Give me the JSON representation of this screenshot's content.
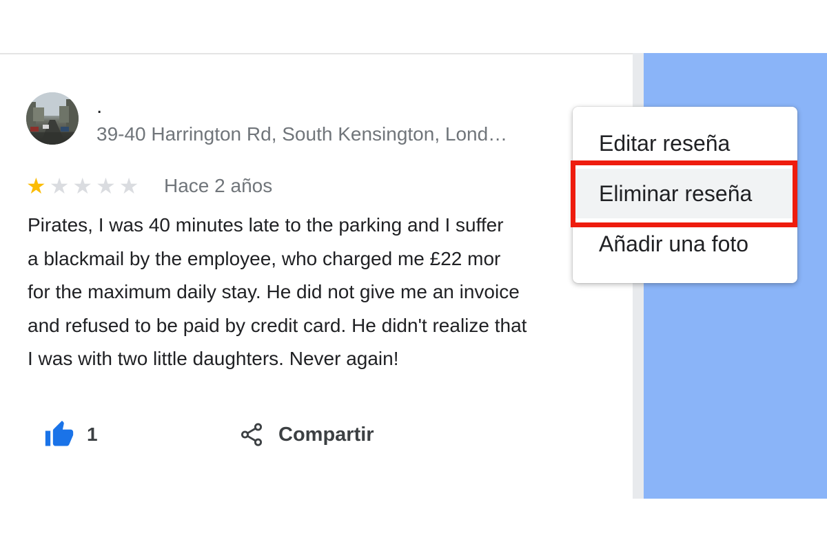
{
  "reviewer": {
    "name": ".",
    "address": "39-40 Harrington Rd, South Kensington, Lond…"
  },
  "rating": {
    "stars_filled": 1,
    "stars_total": 5,
    "date": "Hace 2 años"
  },
  "review": {
    "text": "Pirates, I was 40 minutes late to the parking and I suffer\na blackmail by the employee, who charged me £22  mor\nfor the maximum daily stay. He did not give me an invoice\nand refused to be paid by credit card. He didn't realize that\nI was with two little daughters. Never again!"
  },
  "actions": {
    "like_count": "1",
    "share_label": "Compartir"
  },
  "context_menu": {
    "items": [
      {
        "label": "Editar reseña"
      },
      {
        "label": "Eliminar reseña"
      },
      {
        "label": "Añadir una foto"
      }
    ],
    "highlighted_item": "Eliminar reseña"
  },
  "icons": {
    "like": "thumbs-up-icon",
    "share": "share-icon",
    "star": "star-icon"
  },
  "colors": {
    "star_filled": "#fbbc04",
    "star_empty": "#dadce0",
    "like_icon": "#1a73e8",
    "highlight_border": "#ee1c0e",
    "map_panel": "#8ab4f8"
  }
}
